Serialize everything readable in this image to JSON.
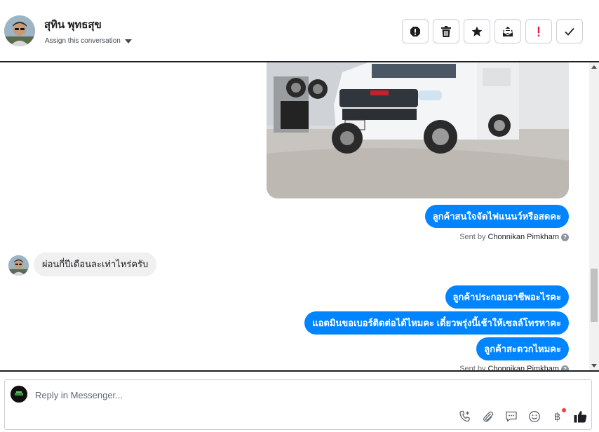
{
  "header": {
    "contact_name": "สุทิน พุทธสุข",
    "assign_label": "Assign this conversation",
    "actions": [
      {
        "name": "spam-icon"
      },
      {
        "name": "trash-icon"
      },
      {
        "name": "star-icon"
      },
      {
        "name": "mark-unread-icon"
      },
      {
        "name": "important-icon"
      },
      {
        "name": "done-icon"
      }
    ]
  },
  "thread": {
    "image": {
      "description_icon": "vehicle-photo"
    },
    "messages": [
      {
        "dir": "out",
        "text": "ลูกค้าสนใจจัดไฟแนนว์หรือสดคะ"
      },
      {
        "dir": "sent_by",
        "prefix": "Sent by",
        "agent": "Chonnikan Pimkham"
      },
      {
        "dir": "in",
        "text": "ผ่อนกี่ปีเดือนละเท่าไหร่ครับ"
      },
      {
        "dir": "out",
        "text": "ลูกค้าประกอบอาชีพอะไรคะ"
      },
      {
        "dir": "out",
        "text": "แอดมินขอเบอร์ติดต่อได้ไหมคะ เดี๋ยวพรุ่งนี้เช้าให้เซลล์โทรหาคะ"
      },
      {
        "dir": "out",
        "text": "ลูกค้าสะดวกไหมคะ"
      },
      {
        "dir": "sent_by",
        "prefix": "Sent by",
        "agent": "Chonnikan Pimkham"
      }
    ]
  },
  "composer": {
    "placeholder": "Reply in Messenger...",
    "tools": [
      "call-icon",
      "attach-icon",
      "saved-replies-icon",
      "emoji-icon",
      "payment-baht-icon",
      "like-icon"
    ],
    "baht_symbol": "฿"
  },
  "colors": {
    "accent": "#0084ff",
    "incoming_bubble": "#f0f0f0",
    "notification_dot": "#fa383e",
    "important": "#e41e3f"
  }
}
